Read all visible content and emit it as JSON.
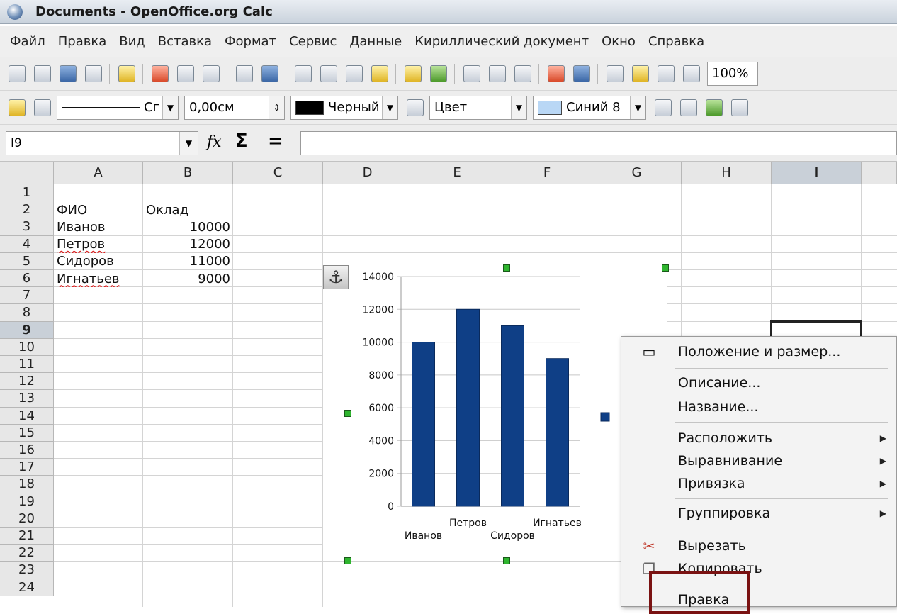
{
  "window": {
    "title": "Documents - OpenOffice.org Calc"
  },
  "menubar": [
    "Файл",
    "Правка",
    "Вид",
    "Вставка",
    "Формат",
    "Сервис",
    "Данные",
    "Кириллический документ",
    "Окно",
    "Справка"
  ],
  "toolbar": {
    "zoom": "100%",
    "line_style_label": "Сг",
    "line_width": "0,00см",
    "line_color": "Черный",
    "area_style": "Цвет",
    "area_color": "Синий 8",
    "colors": {
      "black": "#000000",
      "blue8": "#b9d7f5"
    }
  },
  "formula_bar": {
    "name_box": "I9",
    "fx": "fx",
    "sigma": "Σ",
    "equals": "=",
    "content": ""
  },
  "sheet": {
    "columns": [
      "A",
      "B",
      "C",
      "D",
      "E",
      "F",
      "G",
      "H",
      "I"
    ],
    "selected_column": "I",
    "rows": [
      "1",
      "2",
      "3",
      "4",
      "5",
      "6",
      "7",
      "8",
      "9",
      "10",
      "11",
      "12",
      "13",
      "14",
      "15",
      "16",
      "17",
      "18",
      "19",
      "20",
      "21",
      "22",
      "23",
      "24"
    ],
    "selected_row": "9",
    "cells": {
      "A2": "ФИО",
      "B2": "Оклад",
      "A3": "Иванов",
      "B3": "10000",
      "A4": "Петров",
      "B4": "12000",
      "A5": "Сидоров",
      "B5": "11000",
      "A6": "Игнатьев",
      "B6": "9000"
    }
  },
  "chart_data": {
    "type": "bar",
    "categories": [
      "Иванов",
      "Петров",
      "Сидоров",
      "Игнатьев"
    ],
    "values": [
      10000,
      12000,
      11000,
      9000
    ],
    "ylim": [
      0,
      14000
    ],
    "yticks": [
      "0",
      "2000",
      "4000",
      "6000",
      "8000",
      "10000",
      "12000",
      "14000"
    ],
    "legend_placement": "right",
    "bar_color": "#0f3f86",
    "grid": true
  },
  "context_menu": {
    "items": [
      {
        "label": "Положение и размер...",
        "icon": "position-size-icon"
      },
      {
        "label": "Описание..."
      },
      {
        "label": "Название..."
      },
      {
        "label": "Расположить",
        "submenu": true
      },
      {
        "label": "Выравнивание",
        "submenu": true
      },
      {
        "label": "Привязка",
        "submenu": true
      },
      {
        "label": "Группировка",
        "submenu": true
      },
      {
        "label": "Вырезать",
        "icon": "scissors-icon"
      },
      {
        "label": "Копировать",
        "icon": "copy-icon"
      },
      {
        "label": "Правка"
      }
    ]
  }
}
